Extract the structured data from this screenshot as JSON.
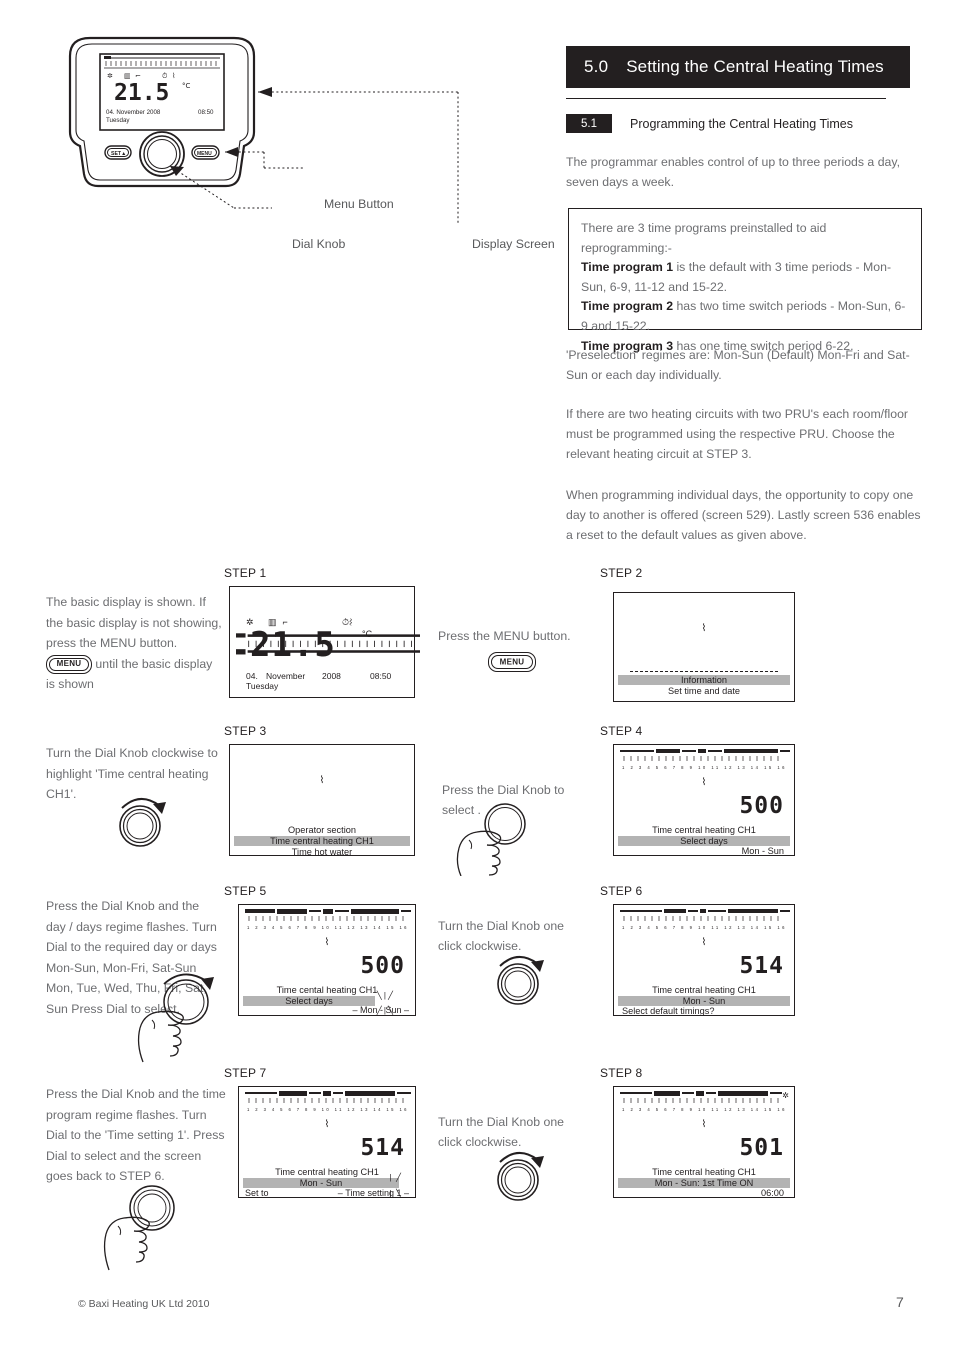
{
  "section": {
    "number": "5.0",
    "title": "Setting the Central Heating Times",
    "sub_number": "5.1",
    "sub_title": "Programming the Central Heating Times"
  },
  "paragraphs": {
    "intro": "The programmar enables control of up to three periods a day, seven days a week.",
    "preselection": "'Preselection' regimes are: Mon-Sun (Default) Mon-Fri and Sat-Sun or each day individually.",
    "pru": "If there are two heating circuits with two PRU's each room/floor must be programmed using the respective PRU. Choose the relevant heating circuit at STEP 3.",
    "copy": "When programming individual days, the opportunity to copy one day to another is offered (screen 529). Lastly screen 536 enables a reset to the default values as given above."
  },
  "callout_box": {
    "lead": "There are 3 time programs preinstalled to aid reprogramming:-",
    "items": [
      {
        "bold": "Time program 1",
        "rest": " is the default with 3 time periods - Mon-Sun, 6-9, 11-12 and 15-22."
      },
      {
        "bold": "Time program 2",
        "rest": " has two time switch periods - Mon-Sun, 6-9 and 15-22."
      },
      {
        "bold": "Time program 3",
        "rest": " has one time switch period 6-22."
      }
    ]
  },
  "device_diagram": {
    "label_menu_button": "Menu Button",
    "label_dial_knob": "Dial Knob",
    "label_display_screen": "Display Screen",
    "screen": {
      "temperature": "21.5",
      "unit": "°C",
      "day_number": "04.",
      "month": "November",
      "year": "2008",
      "time": "08:50",
      "weekday": "Tuesday"
    },
    "menu_button_label": "MENU",
    "set_button_label": "SET"
  },
  "steps": [
    {
      "title": "STEP 1",
      "instruction_pre": "The basic display is shown. If the basic display is not showing, press the MENU button.",
      "button_label": "MENU",
      "instruction_post": "until the basic display is shown",
      "screen": {
        "type": "basic",
        "temperature": "21.5",
        "unit": "°C",
        "day_number": "04.",
        "month": "November",
        "year": "2008",
        "time": "08:50",
        "weekday": "Tuesday"
      }
    },
    {
      "title": "STEP 2",
      "instruction": "Press the MENU button.",
      "button_label": "MENU",
      "screen": {
        "type": "menu",
        "lines": [
          {
            "text": "Information",
            "highlight": true
          },
          {
            "text": "Set time and date",
            "highlight": false
          }
        ]
      }
    },
    {
      "title": "STEP 3",
      "instruction": "Turn the Dial Knob clockwise to highlight 'Time central heating CH1'.",
      "screen": {
        "type": "menu",
        "lines": [
          {
            "text": "Operator  section",
            "highlight": false
          },
          {
            "text": "Time  central heating  CH1",
            "highlight": true
          },
          {
            "text": "Time  hot water",
            "highlight": false
          }
        ]
      }
    },
    {
      "title": "STEP 4",
      "instruction": "Press the Dial Knob to select .",
      "screen": {
        "type": "code",
        "code": "500",
        "lines": [
          {
            "text": "Time  central heating  CH1",
            "highlight": false
          },
          {
            "text": "Select days",
            "highlight": true
          },
          {
            "text": "Mon - Sun",
            "highlight": false,
            "align": "right"
          }
        ]
      }
    },
    {
      "title": "STEP 5",
      "instruction": "Press the Dial Knob and the day / days regime flashes. Turn Dial to the required day or days  Mon-Sun, Mon-Fri, Sat-Sun Mon, Tue, Wed, Thu, Fri, Sat, Sun Press Dial to select.",
      "screen": {
        "type": "code",
        "code": "500",
        "lines": [
          {
            "text": "Time  cental heating  CH1",
            "highlight": false
          },
          {
            "text": "Select days",
            "highlight": true
          },
          {
            "text": "Mon - Sun",
            "highlight": false,
            "align": "right",
            "flashing": true
          }
        ]
      }
    },
    {
      "title": "STEP 6",
      "instruction": "Turn the Dial Knob one click clockwise.",
      "screen": {
        "type": "code",
        "code": "514",
        "lines": [
          {
            "text": "Time  central heating  CH1",
            "highlight": false
          },
          {
            "text": "Mon - Sun",
            "highlight": true
          },
          {
            "text": "Select default timings?",
            "highlight": false,
            "align": "left"
          }
        ]
      }
    },
    {
      "title": "STEP 7",
      "instruction": "Press the Dial Knob and the time program regime flashes. Turn Dial to the 'Time setting 1'. Press Dial to select and the screen goes back to STEP 6.",
      "screen": {
        "type": "code",
        "code": "514",
        "lines": [
          {
            "text": "Time  central heating  CH1",
            "highlight": false
          },
          {
            "text": "Mon - Sun",
            "highlight": true
          },
          {
            "text_left": "Set to",
            "text": "Time setting 1",
            "highlight": false,
            "align": "split",
            "flashing": true
          }
        ]
      }
    },
    {
      "title": "STEP 8",
      "instruction": "Turn the Dial Knob one click clockwise.",
      "screen": {
        "type": "code",
        "code": "501",
        "lines": [
          {
            "text": "Time  central heating  CH1",
            "highlight": false
          },
          {
            "text": "Mon - Sun: 1st Time ON",
            "highlight": true
          },
          {
            "text": "06:00",
            "highlight": false,
            "align": "right"
          }
        ]
      }
    }
  ],
  "footer": {
    "copyright": "© Baxi Heating UK Ltd 2010",
    "page_number": "7"
  },
  "colors": {
    "ink": "#231f20",
    "body_text": "#6d6e71",
    "highlight_bar": "#b3b3b3"
  }
}
